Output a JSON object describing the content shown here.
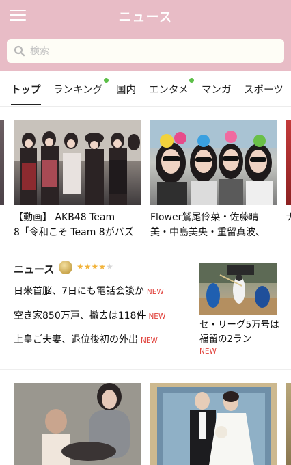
{
  "header": {
    "title": "ニュース",
    "background": "#e8bcc6"
  },
  "search": {
    "placeholder": "検索",
    "icon": "search-icon"
  },
  "tabs": [
    {
      "label": "トップ",
      "active": true,
      "dot": false
    },
    {
      "label": "ランキング",
      "active": false,
      "dot": true
    },
    {
      "label": "国内",
      "active": false,
      "dot": false
    },
    {
      "label": "エンタメ",
      "active": false,
      "dot": true
    },
    {
      "label": "マンガ",
      "active": false,
      "dot": false
    },
    {
      "label": "スポーツ",
      "active": false,
      "dot": false
    }
  ],
  "feature_cards": [
    {
      "line1": "【動画】 AKB48 Team",
      "line2": "8「令和こそ Team 8がバズ"
    },
    {
      "line1": "Flower鷲尾伶菜・佐藤晴",
      "line2": "美・中島美央・重留真波、"
    },
    {
      "line1": "ナ",
      "line2": ""
    }
  ],
  "news": {
    "title": "ニュース",
    "rating": 4,
    "rating_max": 5,
    "headlines": [
      {
        "text": "日米首脳、7日にも電話会談か",
        "badge": "NEW"
      },
      {
        "text": "空き家850万戸、撤去は118件",
        "badge": "NEW"
      },
      {
        "text": "上皇ご夫妻、退位後初の外出",
        "badge": "NEW"
      }
    ],
    "side_story": {
      "text": "セ・リーグ5万号は福留の2ラン",
      "badge": "NEW"
    }
  },
  "colors": {
    "new_badge": "#e0403a",
    "tab_dot": "#5cbf48",
    "star": "#f2b33a"
  }
}
